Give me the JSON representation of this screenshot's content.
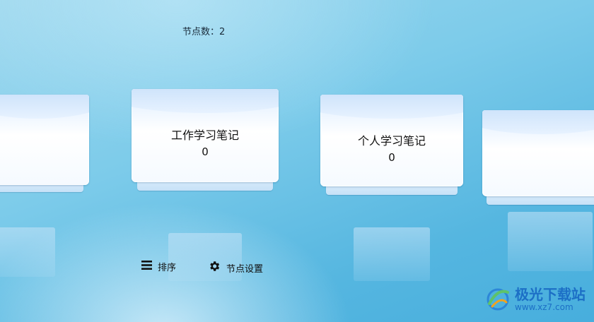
{
  "header": {
    "node_count_label": "节点数：2"
  },
  "folders": [
    {
      "name": "",
      "count": ""
    },
    {
      "name": "工作学习笔记",
      "count": "0"
    },
    {
      "name": "个人学习笔记",
      "count": "0"
    },
    {
      "name": "",
      "count": ""
    }
  ],
  "toolbar": {
    "sort_label": "排序",
    "sort_icon": "menu-lines-icon",
    "settings_label": "节点设置",
    "settings_icon": "gear-icon"
  },
  "watermark": {
    "brand": "极光下载站",
    "url": "www.xz7.com"
  },
  "colors": {
    "background": "#5bb9e2",
    "folder_face": "#ffffff",
    "watermark": "#1c6fc6"
  }
}
